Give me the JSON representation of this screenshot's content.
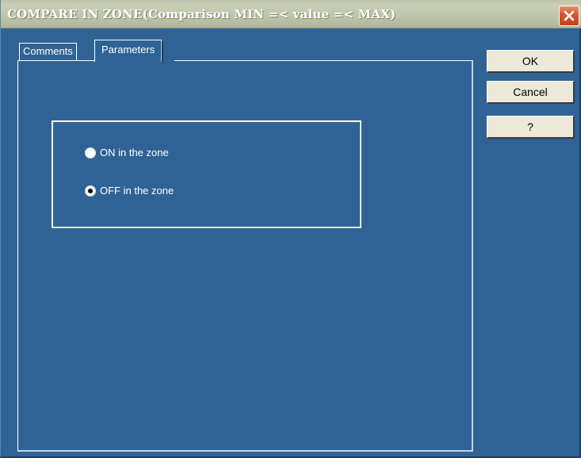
{
  "window": {
    "title": "COMPARE IN ZONE(Comparison MIN =< value =< MAX)",
    "close_icon": "close-icon"
  },
  "tabs": [
    {
      "label": "Comments",
      "selected": false
    },
    {
      "label": "Parameters",
      "selected": true
    }
  ],
  "options": [
    {
      "label": "ON in the zone",
      "checked": false
    },
    {
      "label": "OFF in the zone",
      "checked": true
    }
  ],
  "buttons": {
    "ok": "OK",
    "cancel": "Cancel",
    "help": "?"
  },
  "colors": {
    "background": "#2f6396",
    "titlebar": "#c4cab0",
    "close_button": "#d3562f",
    "button_face": "#ece9d8"
  }
}
